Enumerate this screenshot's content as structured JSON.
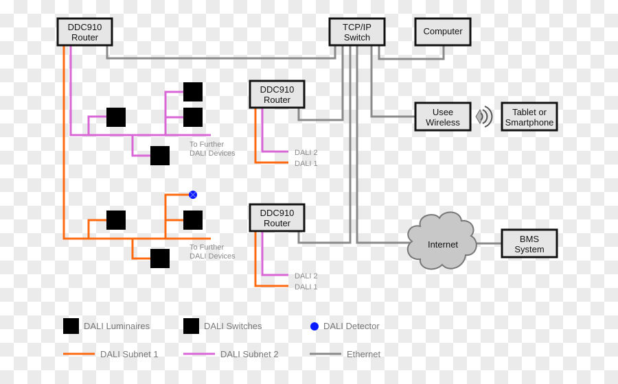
{
  "nodes": {
    "router1": [
      "DDC910",
      "Router"
    ],
    "router2": [
      "DDC910",
      "Router"
    ],
    "router3": [
      "DDC910",
      "Router"
    ],
    "switch": [
      "TCP/IP",
      "Switch"
    ],
    "computer": "Computer",
    "wireless": [
      "Usee",
      "Wireless"
    ],
    "tablet": [
      "Tablet or",
      "Smartphone"
    ],
    "internet": "Internet",
    "bms": [
      "BMS",
      "System"
    ]
  },
  "labels": {
    "further1": [
      "To Further",
      "DALI Devices"
    ],
    "further2": [
      "To Further",
      "DALI Devices"
    ],
    "r2_dali2": "DALI 2",
    "r2_dali1": "DALI 1",
    "r3_dali2": "DALI 2",
    "r3_dali1": "DALI 1"
  },
  "legend": {
    "luminaires": "DALI Luminaires",
    "switches": "DALI Switches",
    "detector": "DALI Detector",
    "subnet1": "DALI Subnet 1",
    "subnet2": "DALI Subnet 2",
    "ethernet": "Ethernet"
  },
  "colors": {
    "dali_subnet_1": "#ff6a10",
    "dali_subnet_2": "#d966d6",
    "ethernet": "#8a8a8a",
    "luminaire_fill": "#7ee81a",
    "detector": "#0a1aff"
  }
}
